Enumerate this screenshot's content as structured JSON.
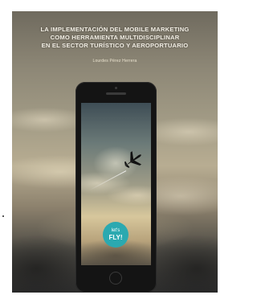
{
  "cover": {
    "title_lines": [
      "LA IMPLEMENTACIÓN DEL MOBILE MARKETING",
      "COMO HERRAMIENTA MULTIDISCIPLINAR",
      "EN EL SECTOR TURÍSTICO Y AEROPORTUARIO"
    ],
    "author": "Lourdes Pérez Herrera"
  },
  "phone_screen": {
    "badge_line1": "let's",
    "badge_line2": "FLY!",
    "badge_color": "#2ba9b0",
    "icon": "airplane-icon"
  }
}
